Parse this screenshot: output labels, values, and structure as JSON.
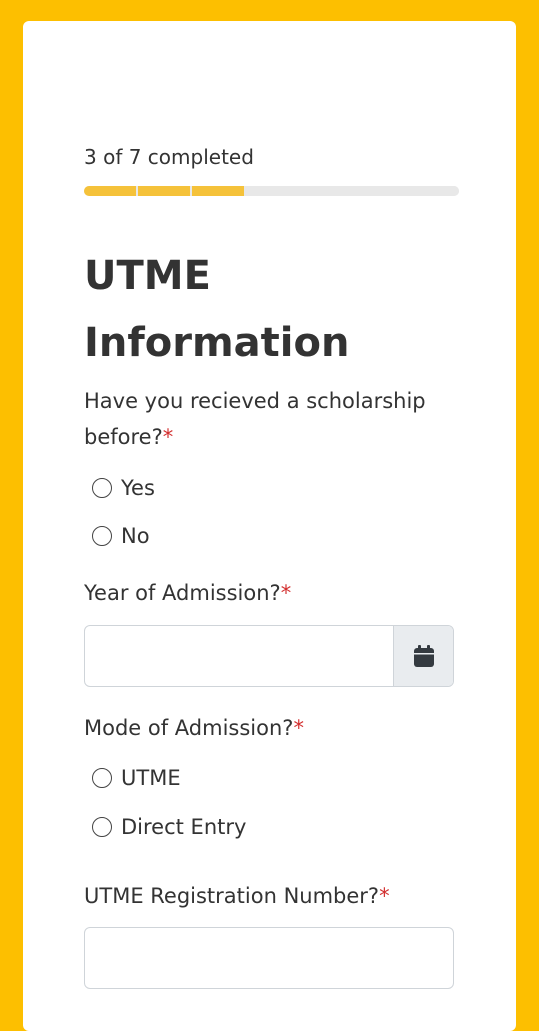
{
  "progress": {
    "label": "3 of 7 completed",
    "completed": 3,
    "total": 7,
    "fill_color": "#F5C23A",
    "track_color": "#E8E8E8"
  },
  "section_title": "UTME Information",
  "questions": {
    "scholarship": {
      "label": "Have you recieved a scholarship before?",
      "required_mark": "*",
      "options": [
        "Yes",
        "No"
      ]
    },
    "year_of_admission": {
      "label": "Year of Admission?",
      "required_mark": "*",
      "value": "",
      "addon_icon": "calendar-icon"
    },
    "mode_of_admission": {
      "label": "Mode of Admission?",
      "required_mark": "*",
      "options": [
        "UTME",
        "Direct Entry"
      ]
    },
    "utme_reg_number": {
      "label": "UTME Registration Number?",
      "required_mark": "*",
      "value": ""
    }
  },
  "colors": {
    "background": "#FDBF00",
    "required": "#D32F2F"
  }
}
